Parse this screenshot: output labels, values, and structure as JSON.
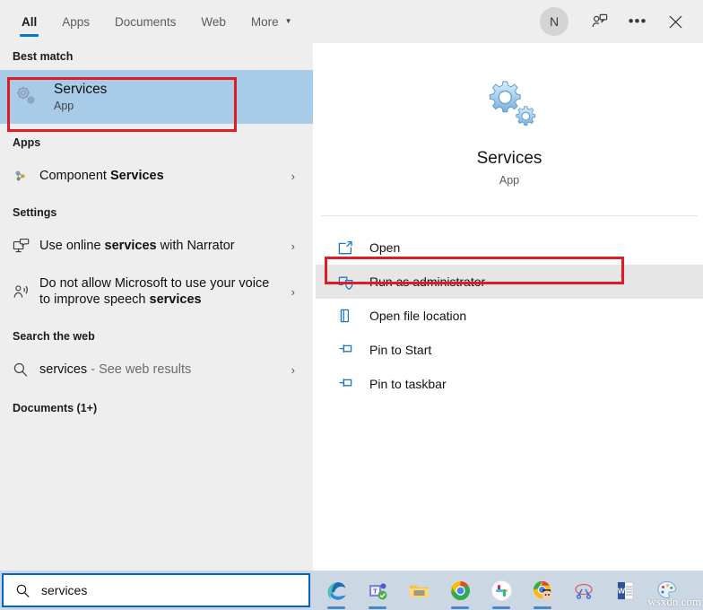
{
  "header": {
    "tabs": [
      {
        "label": "All",
        "active": true
      },
      {
        "label": "Apps",
        "active": false
      },
      {
        "label": "Documents",
        "active": false
      },
      {
        "label": "Web",
        "active": false
      },
      {
        "label": "More",
        "active": false,
        "caret": "▼"
      }
    ],
    "avatar_initial": "N",
    "feedback_icon": "person-feedback-icon",
    "more_icon": "ellipsis-icon",
    "close_icon": "close-icon"
  },
  "left": {
    "best_match_title": "Best match",
    "best_match": {
      "name": "Services",
      "type": "App",
      "icon": "services-gears-icon"
    },
    "apps_title": "Apps",
    "apps": [
      {
        "label": "Component Services",
        "icon": "component-services-icon",
        "chevron": "›"
      }
    ],
    "settings_title": "Settings",
    "settings": [
      {
        "pre": "Use online ",
        "bold": "services",
        "post": " with Narrator",
        "icon": "narrator-screen-icon",
        "chevron": "›"
      },
      {
        "pre": "Do not allow Microsoft to use your voice to improve speech ",
        "bold": "services",
        "post": "",
        "icon": "speech-person-icon",
        "chevron": "›"
      }
    ],
    "web_title": "Search the web",
    "web": [
      {
        "term": "services",
        "suffix": " - See web results",
        "icon": "search-icon",
        "chevron": "›"
      }
    ],
    "documents_title": "Documents (1+)"
  },
  "right": {
    "app_name": "Services",
    "app_type": "App",
    "app_icon": "services-gears-icon",
    "actions": [
      {
        "label": "Open",
        "icon": "open-window-icon",
        "highlighted": false
      },
      {
        "label": "Run as administrator",
        "icon": "shield-admin-icon",
        "highlighted": true
      },
      {
        "label": "Open file location",
        "icon": "folder-location-icon",
        "highlighted": false
      },
      {
        "label": "Pin to Start",
        "icon": "pin-icon",
        "highlighted": false
      },
      {
        "label": "Pin to taskbar",
        "icon": "pin-icon",
        "highlighted": false
      }
    ]
  },
  "taskbar": {
    "search_value": "services",
    "search_icon": "search-icon",
    "apps": [
      {
        "name": "microsoft-edge"
      },
      {
        "name": "microsoft-teams"
      },
      {
        "name": "file-explorer"
      },
      {
        "name": "google-chrome"
      },
      {
        "name": "slack"
      },
      {
        "name": "chrome-profile"
      },
      {
        "name": "snipping-tool"
      },
      {
        "name": "microsoft-word"
      },
      {
        "name": "paint"
      }
    ],
    "watermark": "wsxdn.com"
  },
  "annotations": {
    "accent_blue": "#0078d7",
    "highlight_blue": "#a8cbe8",
    "box_red": "#e01b24"
  }
}
